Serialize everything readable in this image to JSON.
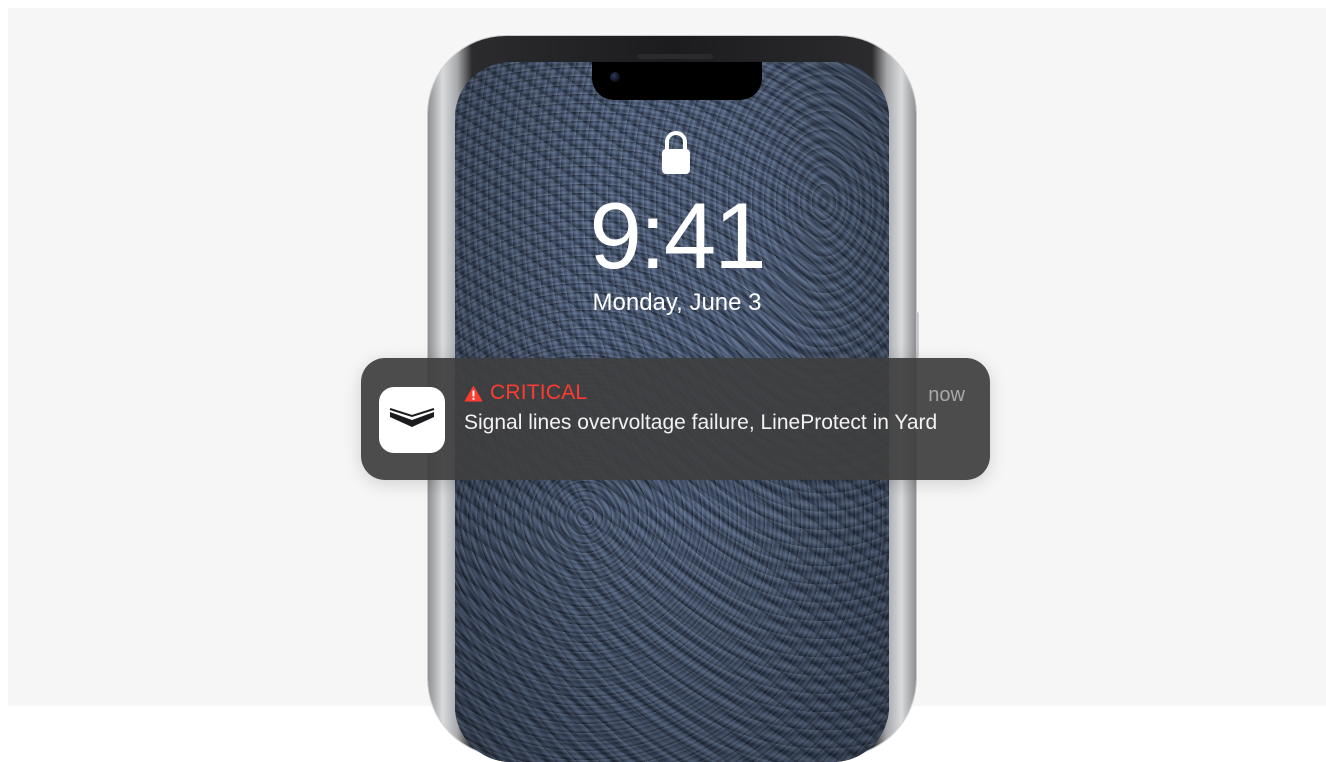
{
  "lock_screen": {
    "time": "9:41",
    "date": "Monday, June 3",
    "lock_icon": "lock-icon"
  },
  "notification": {
    "app_icon": "ajax-logo-icon",
    "severity_icon": "warning-triangle-icon",
    "severity_label": "CRITICAL",
    "timestamp": "now",
    "message": "Signal lines overvoltage failure, LineProtect in Yard",
    "colors": {
      "critical": "#ff3b30",
      "background": "#3e3e40"
    }
  }
}
